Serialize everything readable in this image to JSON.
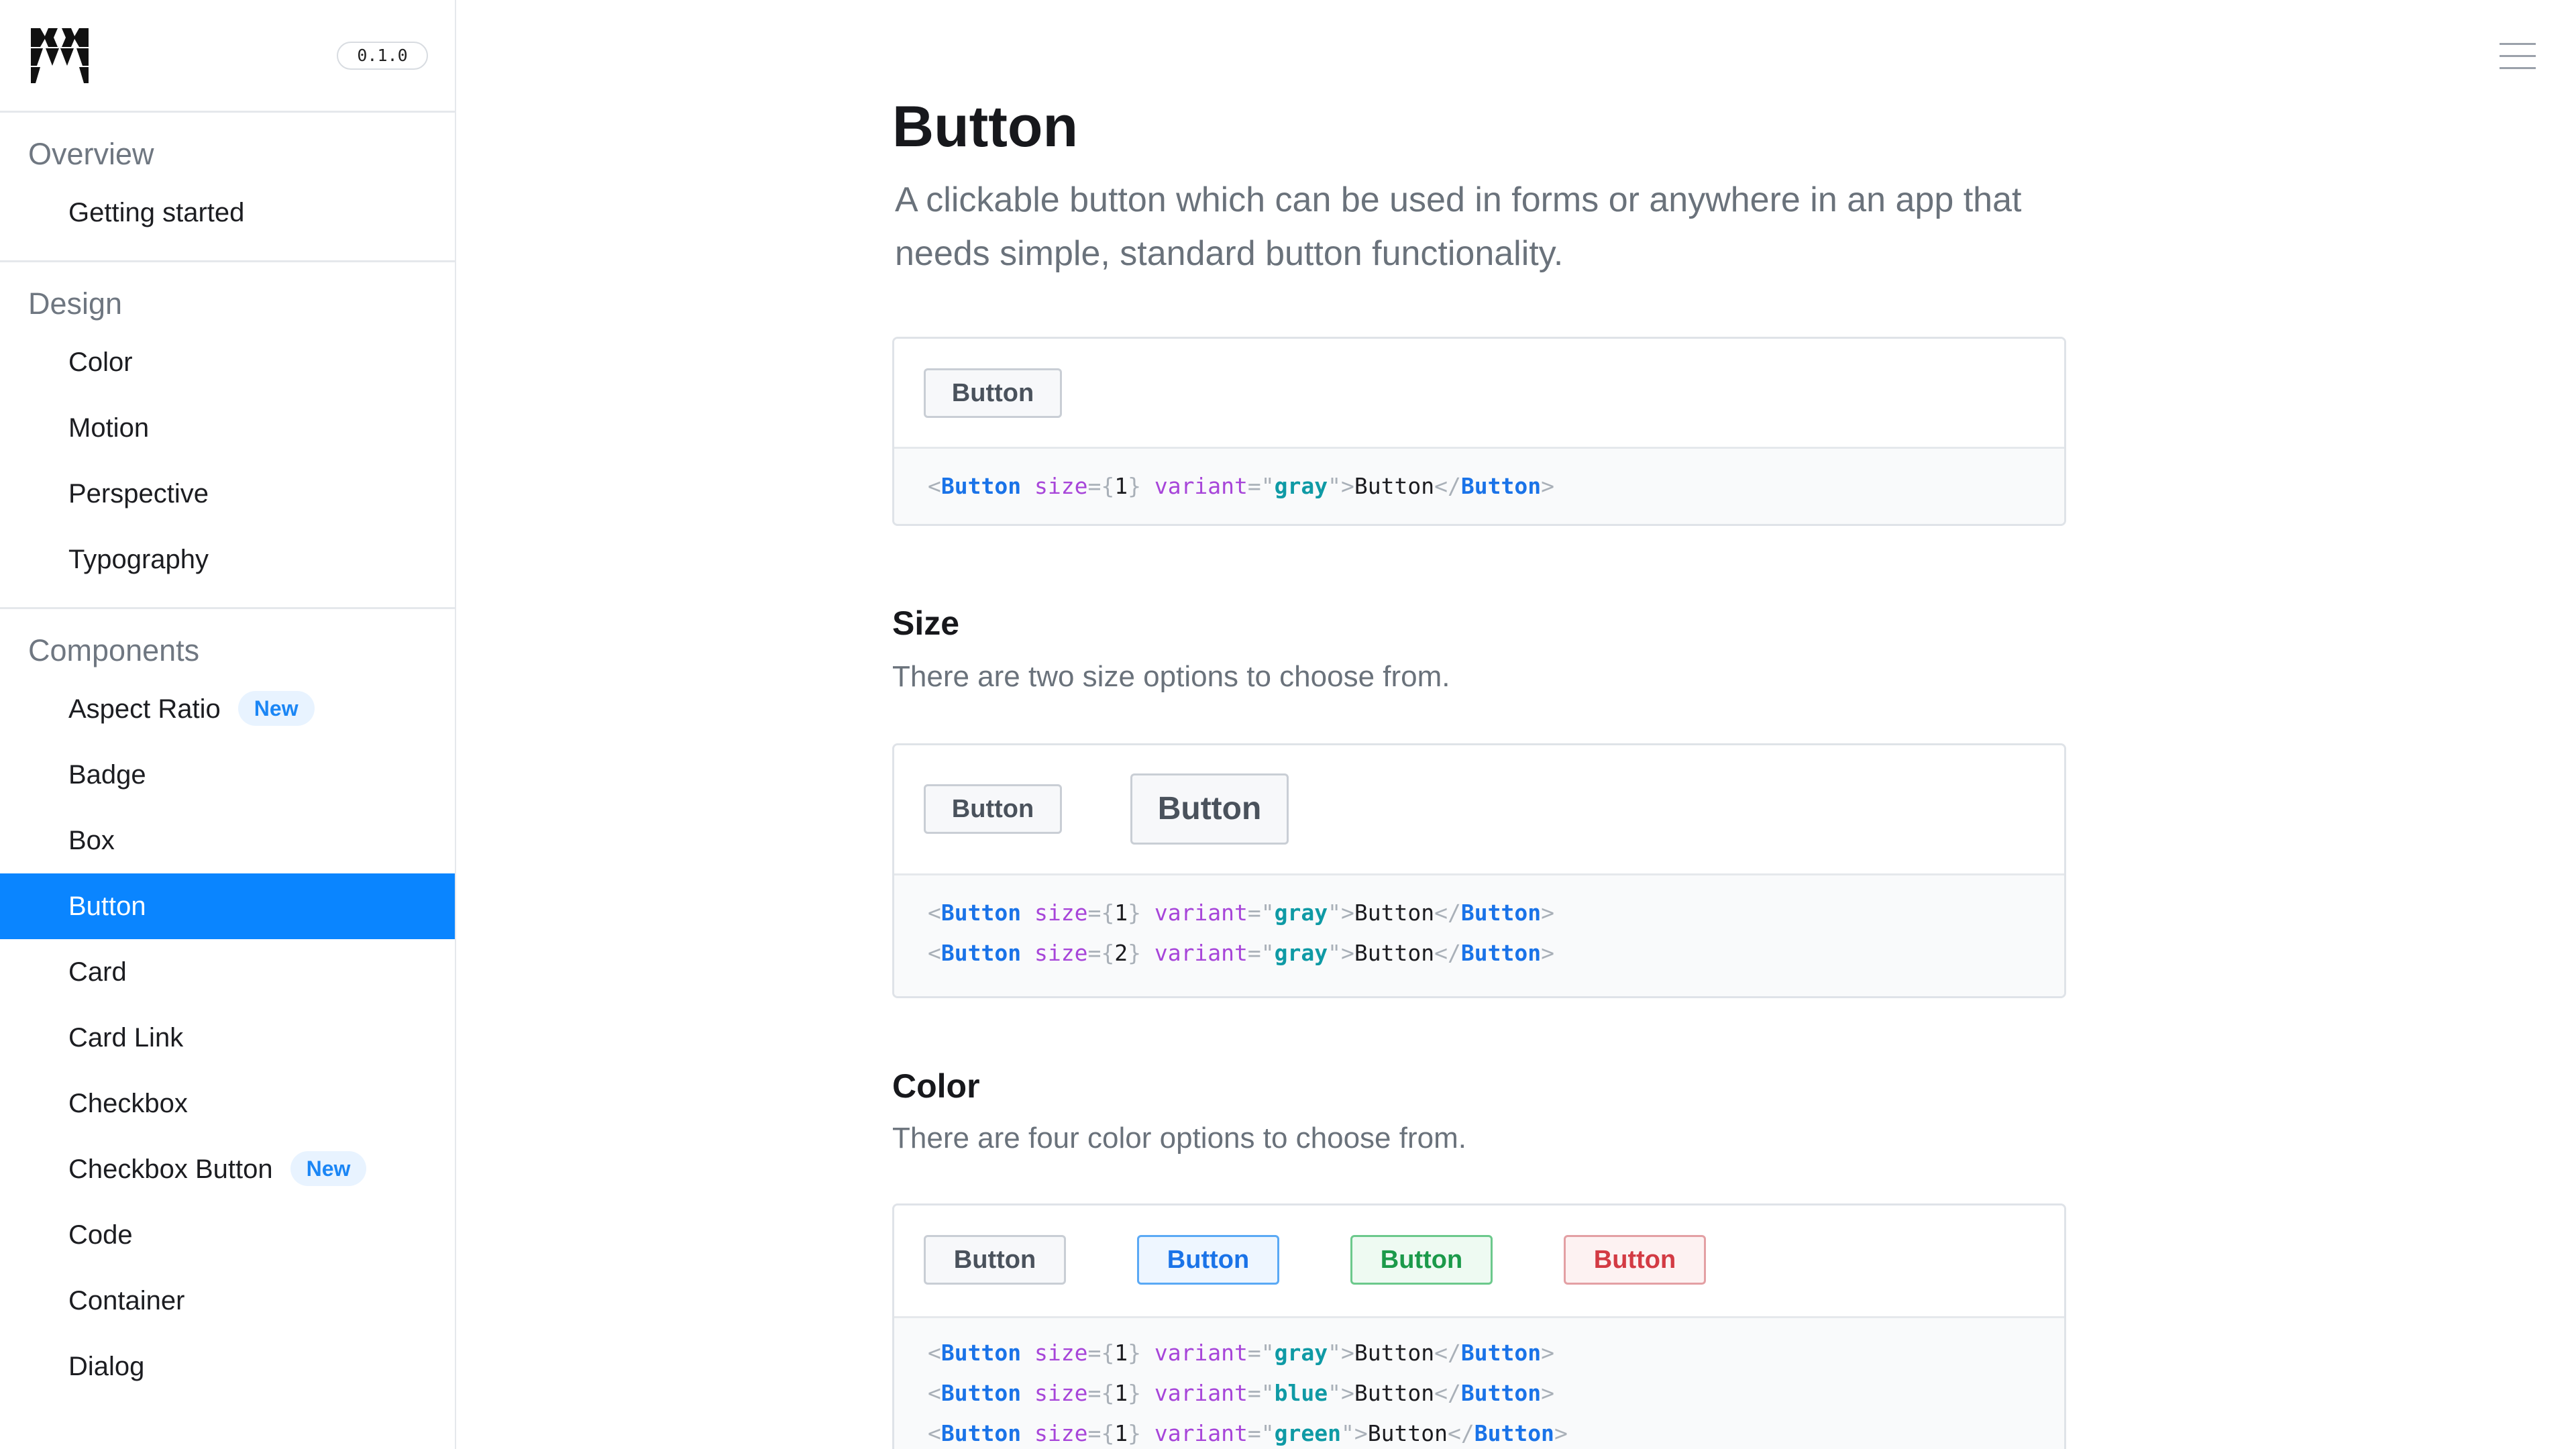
{
  "sidebar": {
    "version": "0.1.0",
    "sections": [
      {
        "title": "Overview",
        "items": [
          {
            "label": "Getting started"
          }
        ]
      },
      {
        "title": "Design",
        "items": [
          {
            "label": "Color"
          },
          {
            "label": "Motion"
          },
          {
            "label": "Perspective"
          },
          {
            "label": "Typography"
          }
        ]
      },
      {
        "title": "Components",
        "items": [
          {
            "label": "Aspect Ratio",
            "badge": "New"
          },
          {
            "label": "Badge"
          },
          {
            "label": "Box"
          },
          {
            "label": "Button",
            "active": true
          },
          {
            "label": "Card"
          },
          {
            "label": "Card Link"
          },
          {
            "label": "Checkbox"
          },
          {
            "label": "Checkbox Button",
            "badge": "New"
          },
          {
            "label": "Code"
          },
          {
            "label": "Container"
          },
          {
            "label": "Dialog"
          }
        ]
      }
    ]
  },
  "page": {
    "title": "Button",
    "description": "A clickable button which can be used in forms or anywhere in an app that needs simple, standard button functionality."
  },
  "examples": {
    "basic": {
      "button_label": "Button",
      "code": [
        {
          "tag": "Button",
          "size": "1",
          "variant": "gray",
          "text": "Button"
        }
      ]
    },
    "size": {
      "heading": "Size",
      "description": "There are two size options to choose from.",
      "buttons": [
        "Button",
        "Button"
      ],
      "code": [
        {
          "tag": "Button",
          "size": "1",
          "variant": "gray",
          "text": "Button"
        },
        {
          "tag": "Button",
          "size": "2",
          "variant": "gray",
          "text": "Button"
        }
      ]
    },
    "color": {
      "heading": "Color",
      "description": "There are four color options to choose from.",
      "buttons": [
        "Button",
        "Button",
        "Button",
        "Button"
      ],
      "code": [
        {
          "tag": "Button",
          "size": "1",
          "variant": "gray",
          "text": "Button"
        },
        {
          "tag": "Button",
          "size": "1",
          "variant": "blue",
          "text": "Button"
        },
        {
          "tag": "Button",
          "size": "1",
          "variant": "green",
          "text": "Button"
        }
      ]
    }
  },
  "colors": {
    "accent": "#0a85ff",
    "blue": "#1a73e8",
    "green": "#1b9a4a",
    "red": "#d33b44",
    "gray": "#4a525c"
  },
  "icons": {
    "logo": "modulz-logo-icon",
    "menu": "hamburger-menu-icon"
  }
}
